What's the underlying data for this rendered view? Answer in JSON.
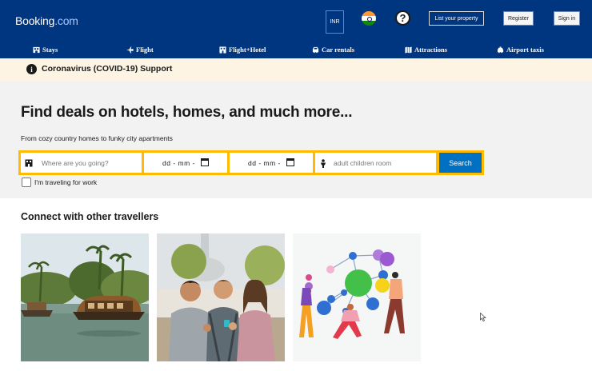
{
  "header": {
    "logo_main": "Booking",
    "logo_suffix": ".com",
    "currency": "INR",
    "help_symbol": "?",
    "list_property": "List your property",
    "register": "Register",
    "sign_in": "Sign in"
  },
  "nav": {
    "items": [
      {
        "label": "Stays",
        "icon": "bed-icon"
      },
      {
        "label": "Flight",
        "icon": "plane-icon"
      },
      {
        "label": "Flight+Hotel",
        "icon": "building-icon"
      },
      {
        "label": "Car rentals",
        "icon": "car-icon"
      },
      {
        "label": "Attractions",
        "icon": "map-icon"
      },
      {
        "label": "Airport taxis",
        "icon": "taxi-icon"
      }
    ]
  },
  "covid": {
    "text": "Coronavirus (COVID-19) Support",
    "icon_symbol": "i"
  },
  "hero": {
    "title": "Find deals on hotels, homes, and much more...",
    "subtitle": "From cozy country homes to funky city apartments"
  },
  "search": {
    "destination_placeholder": "Where are you going?",
    "checkin_value": "dd - mm -",
    "checkout_value": "dd - mm -",
    "guests_placeholder": "adult children room",
    "button": "Search"
  },
  "work_trip": {
    "label": "I'm traveling for work",
    "checked": false
  },
  "connect": {
    "title": "Connect with other travellers",
    "cards": [
      {
        "label": "",
        "image": "houseboat-backwaters-image"
      },
      {
        "label": "",
        "image": "friends-travelling-image"
      },
      {
        "label": "",
        "image": "people-network-illustration"
      }
    ]
  },
  "colors": {
    "brand_blue": "#003580",
    "search_yellow": "#febb02",
    "search_button": "#0071c2",
    "covid_banner": "#fef4e3"
  }
}
